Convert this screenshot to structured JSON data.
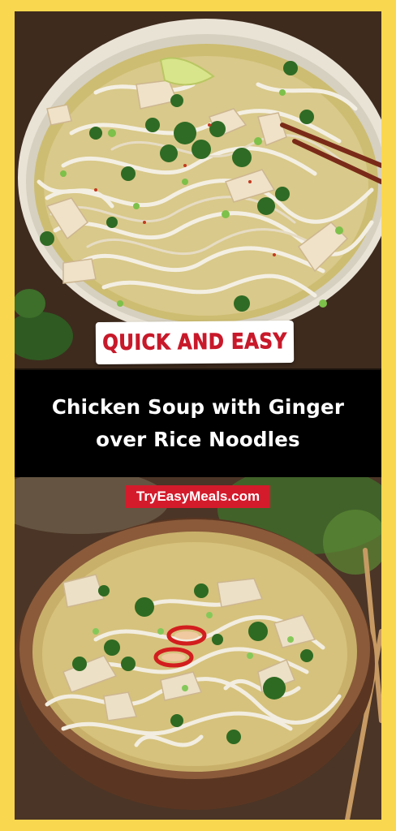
{
  "badge": {
    "text": "QUICK AND EASY"
  },
  "title": {
    "line1": "Chicken Soup with Ginger",
    "line2": "over Rice Noodles"
  },
  "website": {
    "text": "TryEasyMeals.com"
  },
  "colors": {
    "frame": "#f9d74f",
    "badge_text": "#c8192a",
    "title_band": "#000000",
    "url_tag": "#d41b2c"
  }
}
